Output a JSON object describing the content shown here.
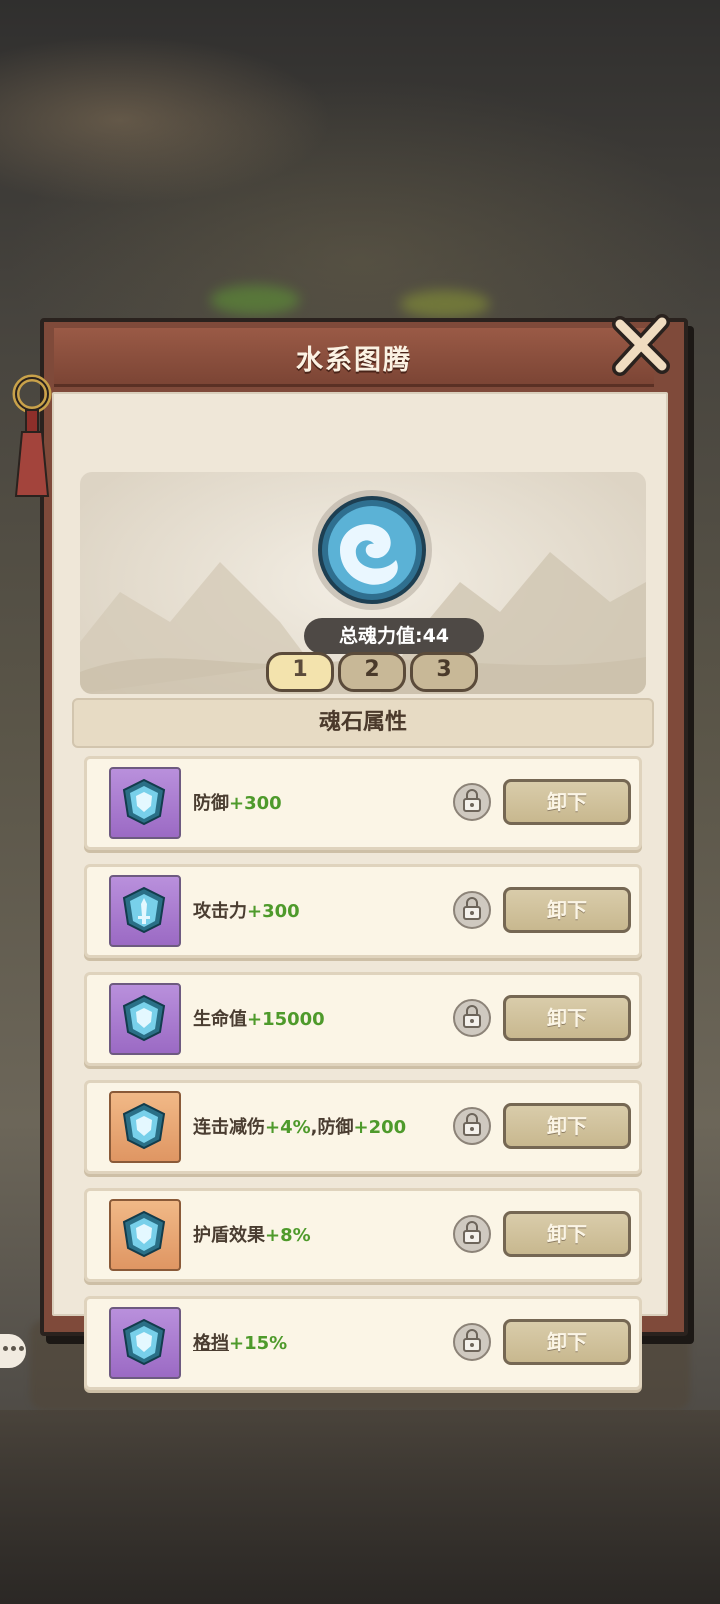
{
  "dialog": {
    "title": "水系图腾",
    "close_icon": "close-x-icon",
    "emblem_icon": "water-swirl-emblem-icon",
    "soul_power_label": "总魂力值:44",
    "page_tabs": [
      {
        "label": "1",
        "active": true
      },
      {
        "label": "2",
        "active": false
      },
      {
        "label": "3",
        "active": false
      }
    ],
    "section_title": "魂石属性",
    "unload_label": "卸下",
    "stones": [
      {
        "name": "防御",
        "value": "+300",
        "frame": "purple",
        "icon": "shield-gem-icon"
      },
      {
        "name": "攻击力",
        "value": "+300",
        "frame": "purple",
        "icon": "sword-gem-icon"
      },
      {
        "name": "生命值",
        "value": "+15000",
        "frame": "purple",
        "icon": "shield-gem-icon"
      },
      {
        "name": "连击减伤",
        "value": "+4%",
        "sep": ",防御",
        "value2": "+200",
        "frame": "orange",
        "icon": "shield-gem-icon"
      },
      {
        "name": "护盾效果",
        "value": "+8%",
        "frame": "orange",
        "icon": "shield-gem-icon"
      },
      {
        "name": "格挡",
        "value": "+15%",
        "frame": "purple",
        "icon": "shield-gem-icon"
      }
    ]
  },
  "colors": {
    "panel_border": "#7f4a3a",
    "value_green": "#4e9a2b",
    "frame_purple": "#a87ccf",
    "frame_orange": "#e9a875"
  }
}
